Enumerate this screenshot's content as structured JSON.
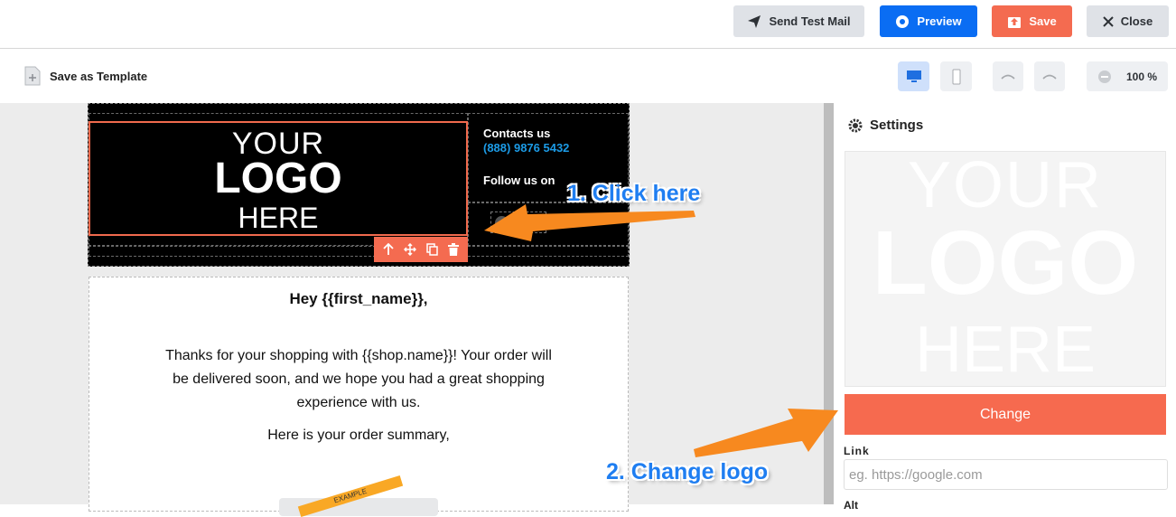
{
  "topbar": {
    "send_test": "Send Test Mail",
    "preview": "Preview",
    "save": "Save",
    "close": "Close"
  },
  "toolbar": {
    "save_template": "Save as Template",
    "zoom": "100 %"
  },
  "email": {
    "logo": [
      "YOUR",
      "LOGO",
      "HERE"
    ],
    "contacts_title": "Contacts us",
    "contacts_phone": "(888) 9876 5432",
    "follow": "Follow us on",
    "greeting": "Hey {{first_name}},",
    "paragraph": "Thanks for your shopping with {{shop.name}}! Your order will be delivered soon, and we hope you had a great shopping experience with us.",
    "summary_intro": "Here is your order summary,",
    "ribbon": "EXAMPLE"
  },
  "settings": {
    "title": "Settings",
    "preview_text": [
      "YOUR",
      "LOGO",
      "HERE"
    ],
    "change": "Change",
    "link_label": "Link",
    "link_placeholder": "eg. https://google.com",
    "alt_label": "Alt"
  },
  "annotations": {
    "step1": "1. Click here",
    "step2": "2. Change logo"
  },
  "colors": {
    "accent_blue": "#0a6df3",
    "accent_orange": "#f46b50",
    "arrow_orange": "#f7891f",
    "phone_blue": "#1c9be6"
  }
}
